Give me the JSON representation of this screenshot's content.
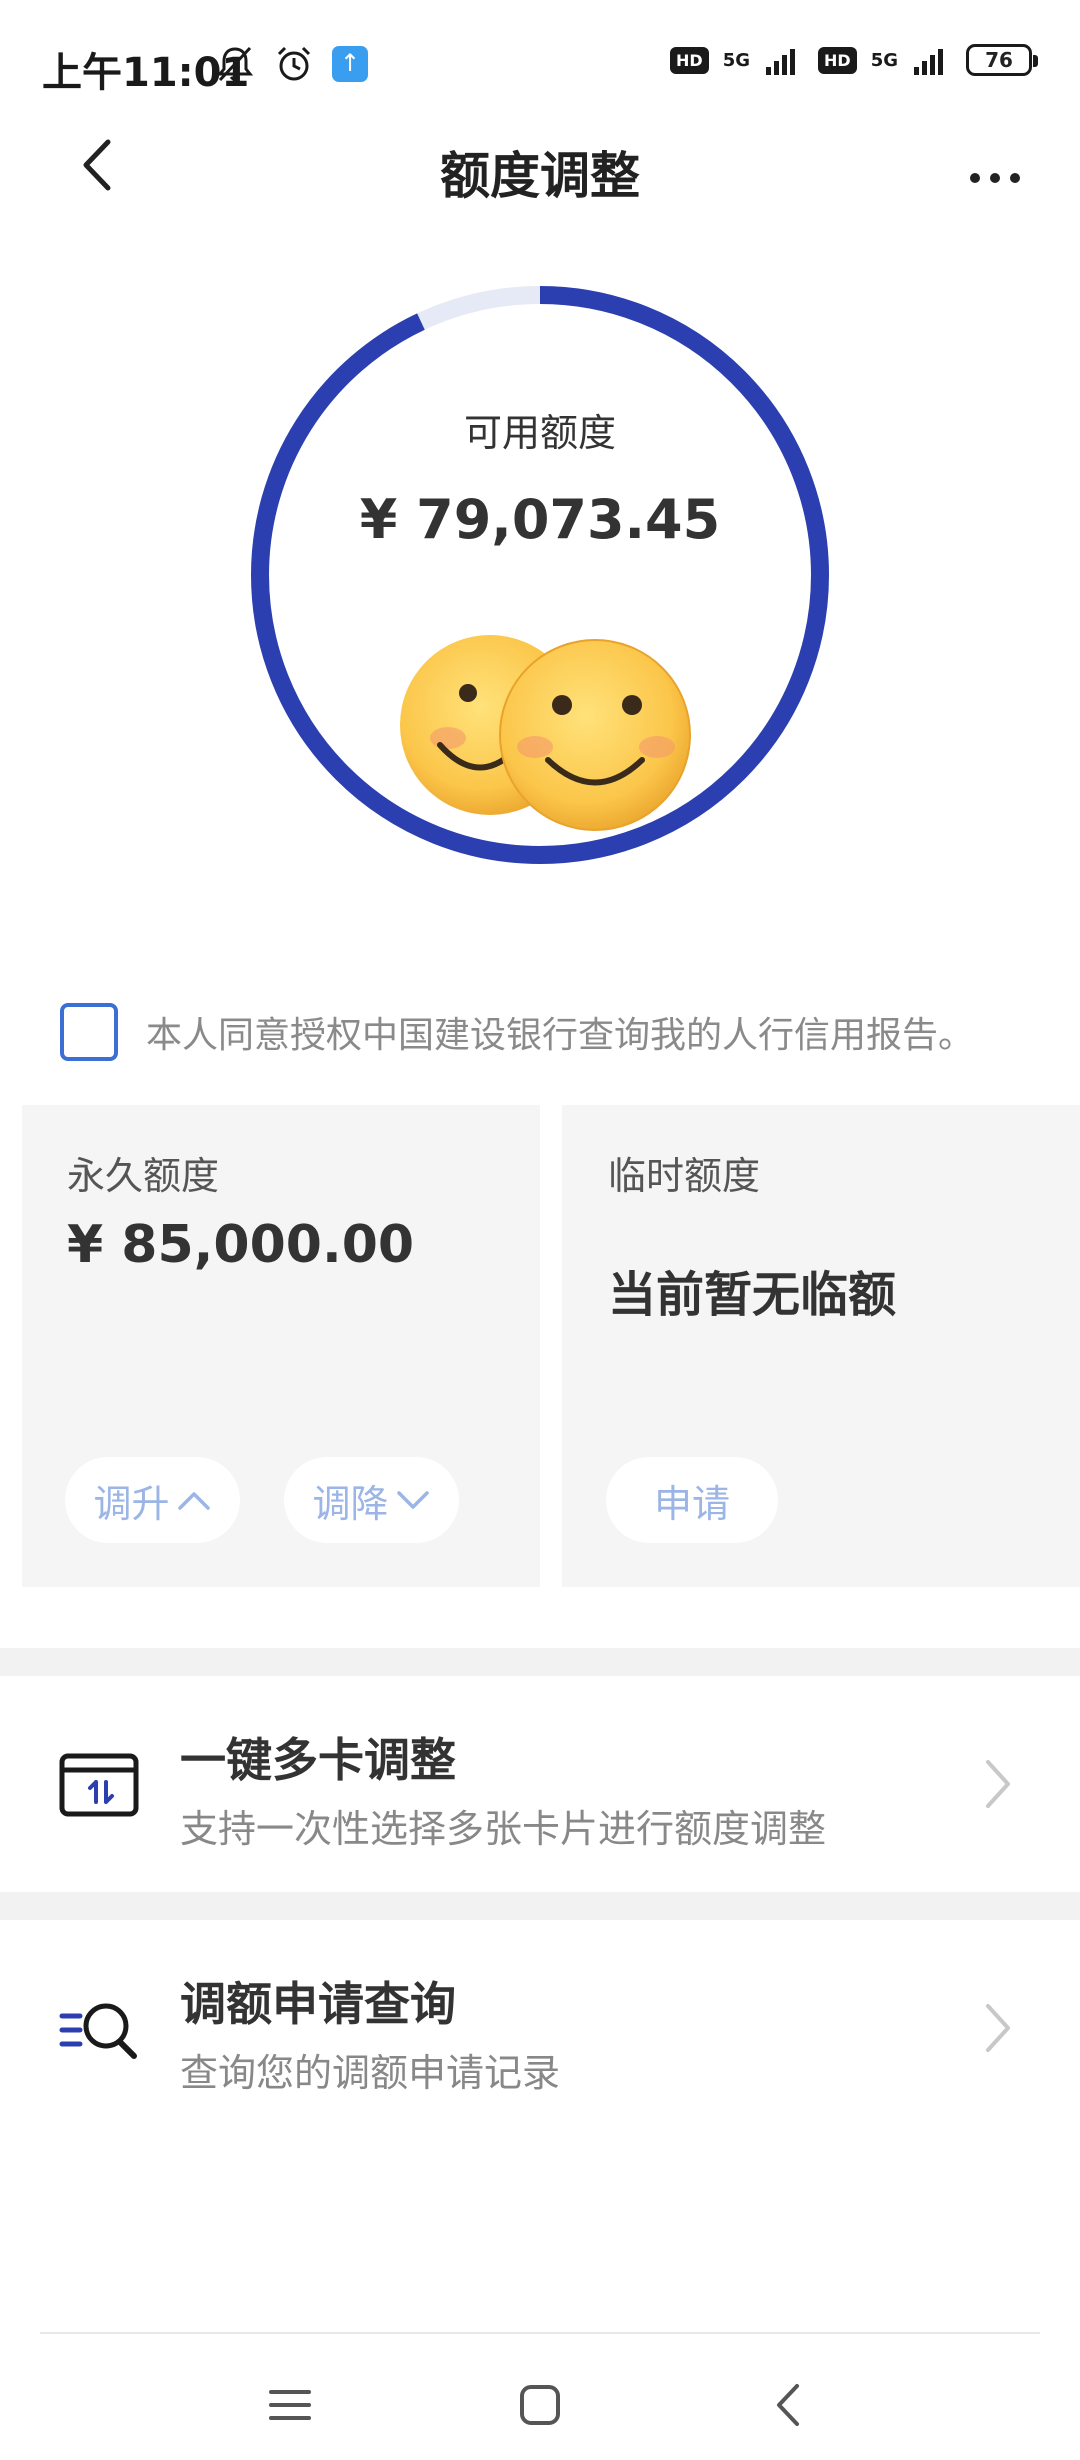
{
  "status_bar": {
    "time": "上午11:01",
    "left_icons": [
      "bell-off-icon",
      "alarm-icon",
      "upload-icon"
    ],
    "hd_badge": "HD",
    "network": "5G",
    "battery": "76"
  },
  "header": {
    "title": "额度调整"
  },
  "available": {
    "label": "可用额度",
    "amount": "¥ 79,073.45",
    "used_fraction": 0.07
  },
  "consent": {
    "text": "本人同意授权中国建设银行查询我的人行信用报告。"
  },
  "permanent": {
    "title": "永久额度",
    "amount": "¥ 85,000.00",
    "raise_label": "调升",
    "lower_label": "调降"
  },
  "temporary": {
    "title": "临时额度",
    "empty_text": "当前暂无临额",
    "apply_label": "申请"
  },
  "menu": [
    {
      "title": "一键多卡调整",
      "subtitle": "支持一次性选择多张卡片进行额度调整",
      "icon": "card-adjust-icon"
    },
    {
      "title": "调额申请查询",
      "subtitle": "查询您的调额申请记录",
      "icon": "search-list-icon"
    }
  ],
  "colors": {
    "ring": "#2b3fb0",
    "ring_track": "#e6eaf6",
    "pill_text": "#9bb5e6",
    "checkbox_border": "#3b6fd4"
  }
}
